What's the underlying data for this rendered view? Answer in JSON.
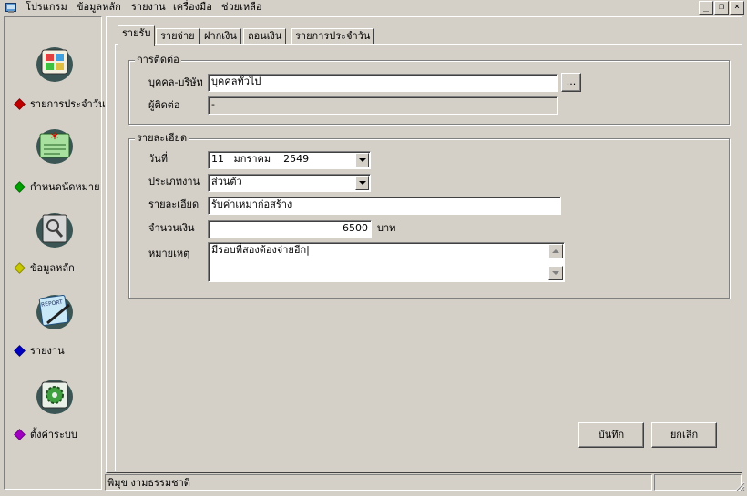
{
  "menu": {
    "items": [
      "โปรแกรม",
      "ข้อมูลหลัก",
      "รายงาน",
      "เครื่องมือ",
      "ช่วยเหลือ"
    ]
  },
  "window_controls": {
    "minimize": "_",
    "restore": "❐",
    "close": "×"
  },
  "sidebar": {
    "items": [
      {
        "label": "รายการประจำวัน",
        "icon": "daily-list-icon",
        "color": "#c00000"
      },
      {
        "label": "กำหนดนัดหมาย",
        "icon": "appointment-card-icon",
        "color": "#00a000"
      },
      {
        "label": "ข้อมูลหลัก",
        "icon": "master-data-icon",
        "color": "#c8c800"
      },
      {
        "label": "รายงาน",
        "icon": "report-icon",
        "color": "#0000c0"
      },
      {
        "label": "ตั้งค่าระบบ",
        "icon": "settings-gear-icon",
        "color": "#a000c0"
      }
    ]
  },
  "tabs": [
    "รายรับ",
    "รายจ่าย",
    "ฝากเงิน",
    "ถอนเงิน",
    "รายการประจำวัน"
  ],
  "active_tab": 0,
  "contact": {
    "title": "การติดต่อ",
    "person_label": "บุคคล-บริษัท",
    "person_value": "บุคคลทั่วไป",
    "browse_label": "...",
    "contact_label": "ผู้ติดต่อ",
    "contact_value": "-"
  },
  "details": {
    "title": "รายละเอียด",
    "date_label": "วันที่",
    "date_day": "11",
    "date_month": "มกราคม",
    "date_year": "2549",
    "type_label": "ประเภทงาน",
    "type_value": "ส่วนตัว",
    "desc_label": "รายละเอียด",
    "desc_value": "รับค่าเหมาก่อสร้าง",
    "amount_label": "จำนวนเงิน",
    "amount_value": "6500",
    "amount_unit": "บาท",
    "note_label": "หมายเหตุ",
    "note_value": "มีรอบที่สองต้องจ่ายอีก|"
  },
  "buttons": {
    "save": "บันทึก",
    "cancel": "ยกเลิก"
  },
  "status": {
    "user": "พิมุข งามธรรมชาติ",
    "panel2": ""
  }
}
